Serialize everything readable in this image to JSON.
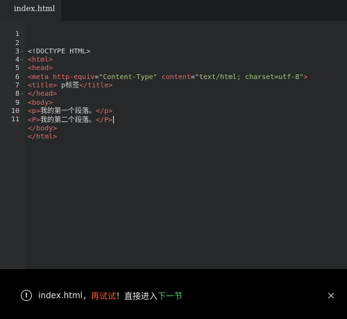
{
  "tab": {
    "filename": "index.html"
  },
  "editor": {
    "lines": [
      {
        "n": "1",
        "fold": ""
      },
      {
        "n": "2",
        "fold": "▾"
      },
      {
        "n": "3",
        "fold": "▾"
      },
      {
        "n": "4",
        "fold": ""
      },
      {
        "n": "5",
        "fold": ""
      },
      {
        "n": "6",
        "fold": ""
      },
      {
        "n": "7",
        "fold": "▾"
      },
      {
        "n": "8",
        "fold": ""
      },
      {
        "n": "9",
        "fold": ""
      },
      {
        "n": "10",
        "fold": ""
      },
      {
        "n": "11",
        "fold": ""
      }
    ],
    "code": {
      "l1": "<!DOCTYPE HTML>",
      "l2": "<html>",
      "l3": "<head>",
      "l4_tag_open": "<meta ",
      "l4_attr1": "http-equiv",
      "l4_eq1": "=",
      "l4_val1": "\"Content-Type\"",
      "l4_attr2": " content",
      "l4_eq2": "=",
      "l4_val2": "\"text/html; charset=utf-8\"",
      "l4_tag_close": ">",
      "l5_open": "<title>",
      "l5_text": " p标签",
      "l5_close": "</title>",
      "l6": "</head>",
      "l7": "<body>",
      "l8_open": "<p>",
      "l8_text": "我的第一个段落。",
      "l8_close": "</p>",
      "l9_open": "<P>",
      "l9_text": "我的第二个段落。",
      "l9_close": "</P>",
      "l10": "</body>",
      "l11": "</html>"
    }
  },
  "notification": {
    "icon": "alert-circle-icon",
    "filename": "index.html",
    "comma": "，",
    "retry": "再试试",
    "exclaim": "！",
    "direct": "直接进入",
    "next": "下一节",
    "close_symbol": "×"
  },
  "colors": {
    "tag": "#e06c6c",
    "string": "#a9c77c",
    "retry": "#ff5a3a",
    "next": "#4fd25a"
  }
}
